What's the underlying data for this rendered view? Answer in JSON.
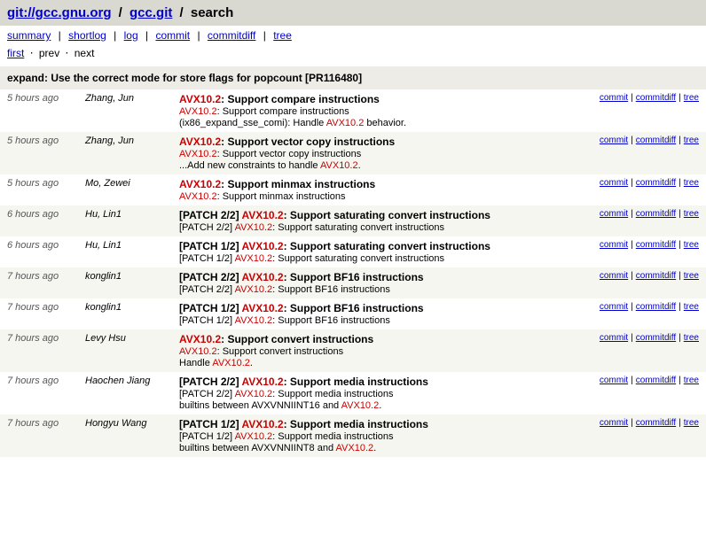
{
  "header": {
    "repo_base": "git://gcc.gnu.org",
    "slash1": "/",
    "repo_name": "gcc.git",
    "slash2": "/",
    "page": "search"
  },
  "nav": {
    "items": [
      "summary",
      "shortlog",
      "log",
      "commit",
      "commitdiff",
      "tree"
    ],
    "sep": "|"
  },
  "pager": {
    "first": "first",
    "prev": "prev",
    "next": "next",
    "dot": "⋅"
  },
  "commit_title": "expand: Use the correct mode for store flags for popcount [PR116480]",
  "link_labels": {
    "commit": "commit",
    "commitdiff": "commitdiff",
    "tree": "tree",
    "pipe": "|"
  },
  "avx_token": "AVX10.2",
  "rows": [
    {
      "age": "5 hours ago",
      "author": "Zhang, Jun",
      "subject_pre": "",
      "subject_post": ": Support compare instructions",
      "subject_has_avx": true,
      "lines": [
        {
          "pre": "",
          "avx": true,
          "post": ": Support compare instructions"
        },
        {
          "pre": "(ix86_expand_sse_comi): Handle ",
          "avx": true,
          "post": " behavior."
        }
      ]
    },
    {
      "age": "5 hours ago",
      "author": "Zhang, Jun",
      "subject_pre": "",
      "subject_post": ": Support vector copy instructions",
      "subject_has_avx": true,
      "lines": [
        {
          "pre": "",
          "avx": true,
          "post": ": Support vector copy instructions"
        },
        {
          "pre": "...Add new constraints to handle ",
          "avx": true,
          "post": "."
        }
      ]
    },
    {
      "age": "5 hours ago",
      "author": "Mo, Zewei",
      "subject_pre": "",
      "subject_post": ": Support minmax instructions",
      "subject_has_avx": true,
      "lines": [
        {
          "pre": "",
          "avx": true,
          "post": ": Support minmax instructions"
        }
      ]
    },
    {
      "age": "6 hours ago",
      "author": "Hu, Lin1",
      "subject_pre": "[PATCH 2/2] ",
      "subject_post": ": Support saturating convert instructions",
      "subject_has_avx": true,
      "lines": [
        {
          "pre": "[PATCH 2/2] ",
          "avx": true,
          "post": ": Support saturating convert instructions"
        }
      ]
    },
    {
      "age": "6 hours ago",
      "author": "Hu, Lin1",
      "subject_pre": "[PATCH 1/2] ",
      "subject_post": ": Support saturating convert instructions",
      "subject_has_avx": true,
      "lines": [
        {
          "pre": "[PATCH 1/2] ",
          "avx": true,
          "post": ": Support saturating convert instructions"
        }
      ]
    },
    {
      "age": "7 hours ago",
      "author": "konglin1",
      "subject_pre": "[PATCH 2/2] ",
      "subject_post": ": Support BF16 instructions",
      "subject_has_avx": true,
      "lines": [
        {
          "pre": "[PATCH 2/2] ",
          "avx": true,
          "post": ": Support BF16 instructions"
        }
      ]
    },
    {
      "age": "7 hours ago",
      "author": "konglin1",
      "subject_pre": "[PATCH 1/2] ",
      "subject_post": ": Support BF16 instructions",
      "subject_has_avx": true,
      "lines": [
        {
          "pre": "[PATCH 1/2] ",
          "avx": true,
          "post": ": Support BF16 instructions"
        }
      ]
    },
    {
      "age": "7 hours ago",
      "author": "Levy Hsu",
      "subject_pre": "",
      "subject_post": ": Support convert instructions",
      "subject_has_avx": true,
      "lines": [
        {
          "pre": "",
          "avx": true,
          "post": ": Support convert instructions"
        },
        {
          "pre": "Handle ",
          "avx": true,
          "post": "."
        }
      ]
    },
    {
      "age": "7 hours ago",
      "author": "Haochen Jiang",
      "subject_pre": "[PATCH 2/2] ",
      "subject_post": ": Support media instructions",
      "subject_has_avx": true,
      "lines": [
        {
          "pre": "[PATCH 2/2] ",
          "avx": true,
          "post": ": Support media instructions"
        },
        {
          "pre": "builtins between AVXVNNIINT16 and ",
          "avx": true,
          "post": "."
        }
      ]
    },
    {
      "age": "7 hours ago",
      "author": "Hongyu Wang",
      "subject_pre": "[PATCH 1/2] ",
      "subject_post": ": Support media instructions",
      "subject_has_avx": true,
      "lines": [
        {
          "pre": "[PATCH 1/2] ",
          "avx": true,
          "post": ": Support media instructions"
        },
        {
          "pre": "builtins between AVXVNNIINT8 and ",
          "avx": true,
          "post": "."
        }
      ]
    }
  ]
}
